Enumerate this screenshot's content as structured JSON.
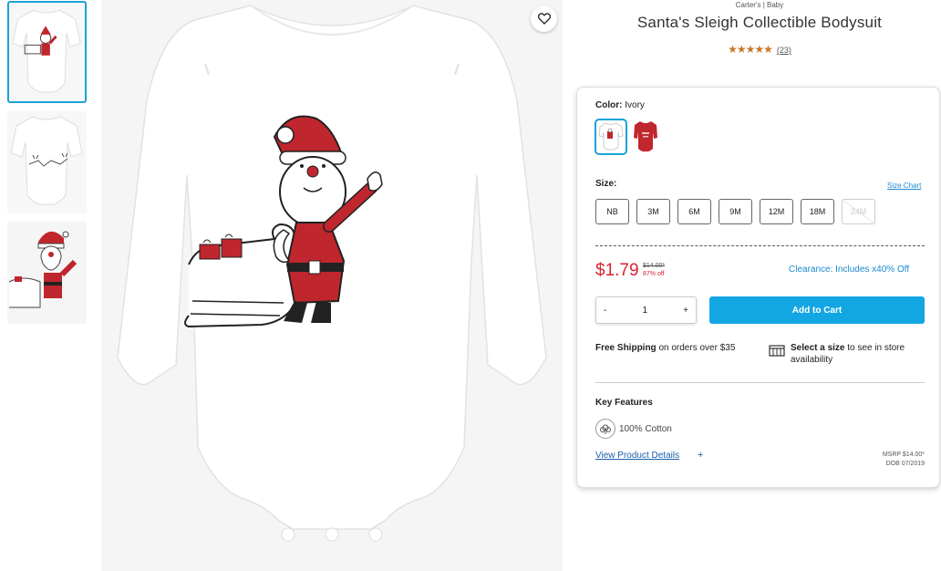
{
  "product": {
    "brand": "Carter's | Baby",
    "title": "Santa's Sleigh Collectible Bodysuit",
    "stars": "★★★★★",
    "review_count": "(23)",
    "rating": 5
  },
  "color": {
    "label": "Color:",
    "selected": "Ivory",
    "swatches": [
      "ivory-bodysuit",
      "red-bodysuit"
    ]
  },
  "size": {
    "label": "Size:",
    "chart_link": "Size Chart",
    "options": [
      "NB",
      "3M",
      "6M",
      "9M",
      "12M",
      "18M",
      "24M"
    ]
  },
  "price": {
    "current": "$1.79",
    "was": "$14.00*",
    "discount": "87% off",
    "clearance": "Clearance: Includes x40% Off"
  },
  "cart": {
    "minus": "-",
    "quantity": "1",
    "plus": "+",
    "add_label": "Add to Cart"
  },
  "shipping": {
    "bold": "Free Shipping",
    "rest": " on orders over $35"
  },
  "store": {
    "bold": "Select a size",
    "rest": " to see in store availability"
  },
  "features": {
    "heading": "Key Features",
    "items": [
      "100% Cotton"
    ],
    "details_link": "View Product Details",
    "details_plus": "+",
    "msrp": "MSRP $14.00*",
    "dob": "DOB 07/2019"
  },
  "colors": {
    "accent": "#12a6e2",
    "sale": "#d9232e",
    "link": "#1a8ad3",
    "star": "#c8792a"
  }
}
